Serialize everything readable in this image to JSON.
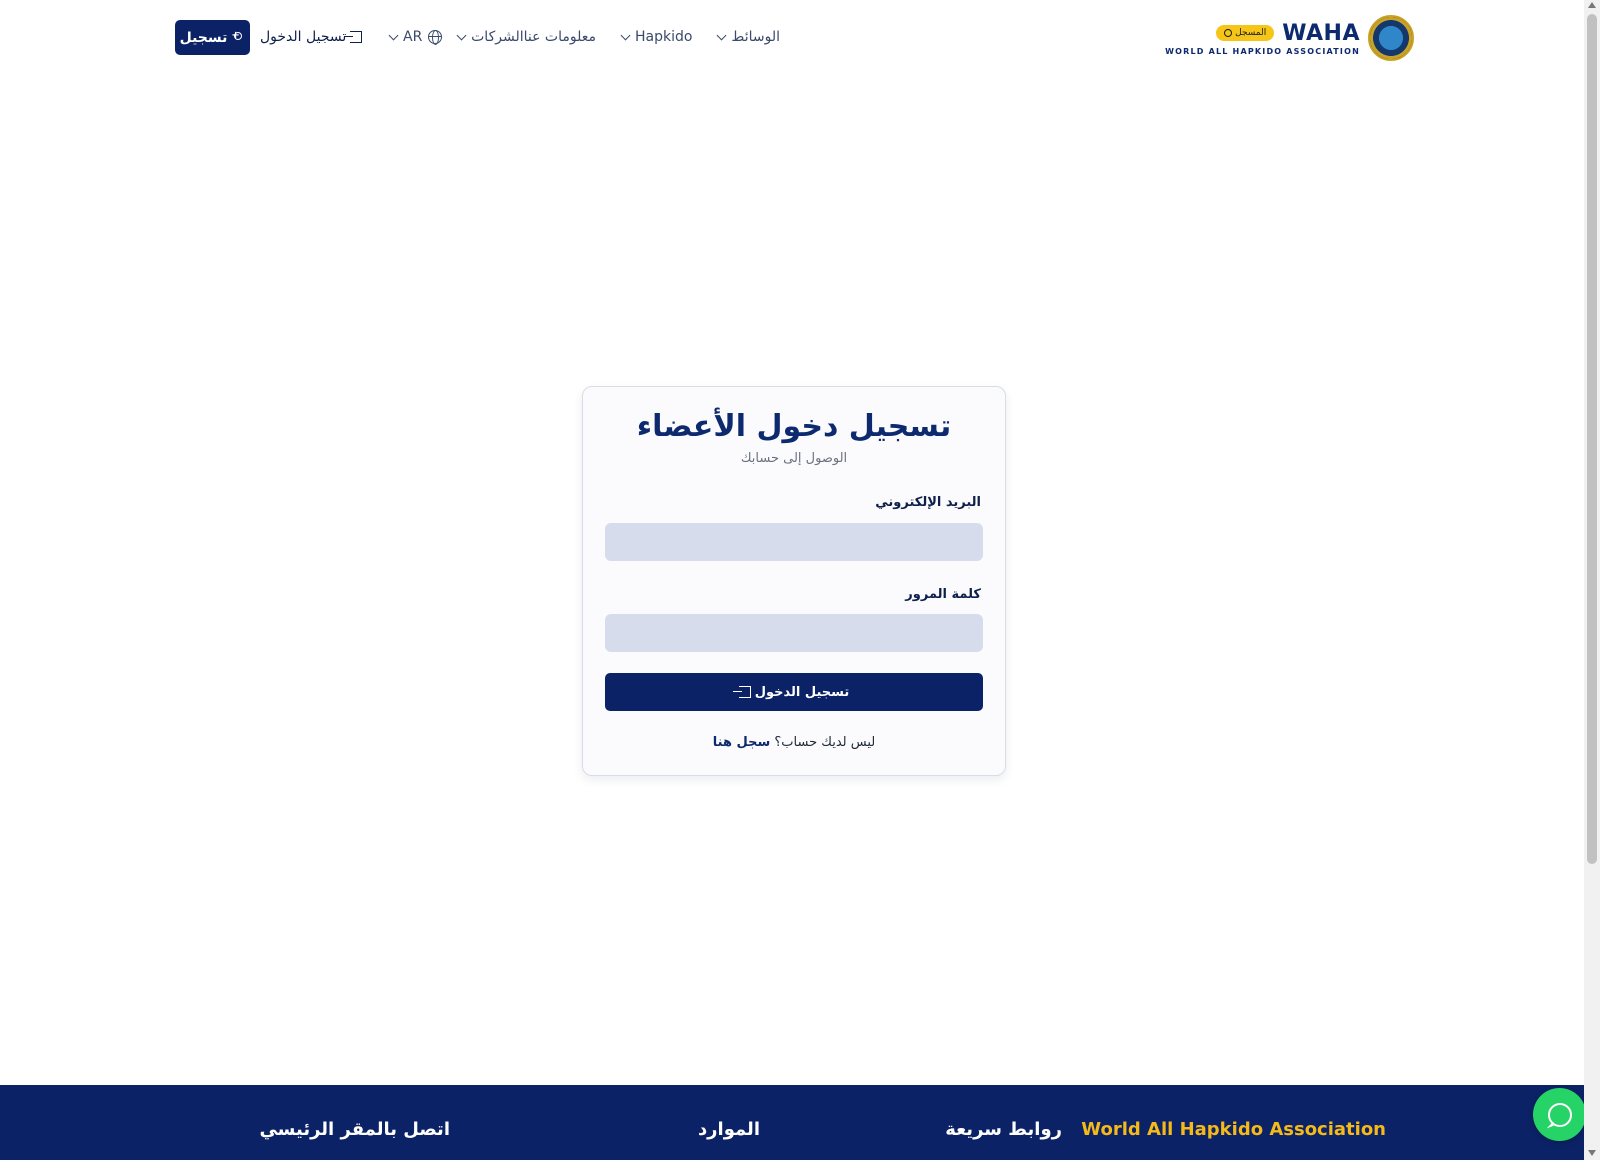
{
  "header": {
    "logo": {
      "word": "WAHA",
      "sub": "WORLD ALL HAPKIDO ASSOCIATION",
      "badge": "المسجل"
    },
    "nav": [
      {
        "label": "معلومات عنا"
      },
      {
        "label": "الشركات"
      },
      {
        "label": "Hapkido"
      },
      {
        "label": "الوسائط"
      }
    ],
    "language": "AR",
    "login_label": "تسجيل الدخول",
    "register_label": "تسجيل"
  },
  "login_card": {
    "title": "تسجيل دخول الأعضاء",
    "subtitle": "الوصول إلى حسابك",
    "email_label": "البريد الإلكتروني",
    "email_value": "",
    "password_label": "كلمة المرور",
    "password_value": "",
    "submit_label": "تسجيل الدخول",
    "footer_prompt": "ليس لديك حساب؟",
    "footer_link": "سجل هنا"
  },
  "footer": {
    "brand": "World All Hapkido Association",
    "quick_links": "روابط سريعة",
    "resources": "الموارد",
    "contact": "اتصل بالمقر الرئيسي"
  },
  "colors": {
    "primary": "#0b2266",
    "accent": "#f5b91a",
    "whatsapp": "#25d366",
    "input_bg": "#d7dcec"
  },
  "icons": [
    "seal-icon",
    "chevron-down-icon",
    "globe-icon",
    "sign-in-icon",
    "user-plus-icon",
    "whatsapp-icon"
  ]
}
